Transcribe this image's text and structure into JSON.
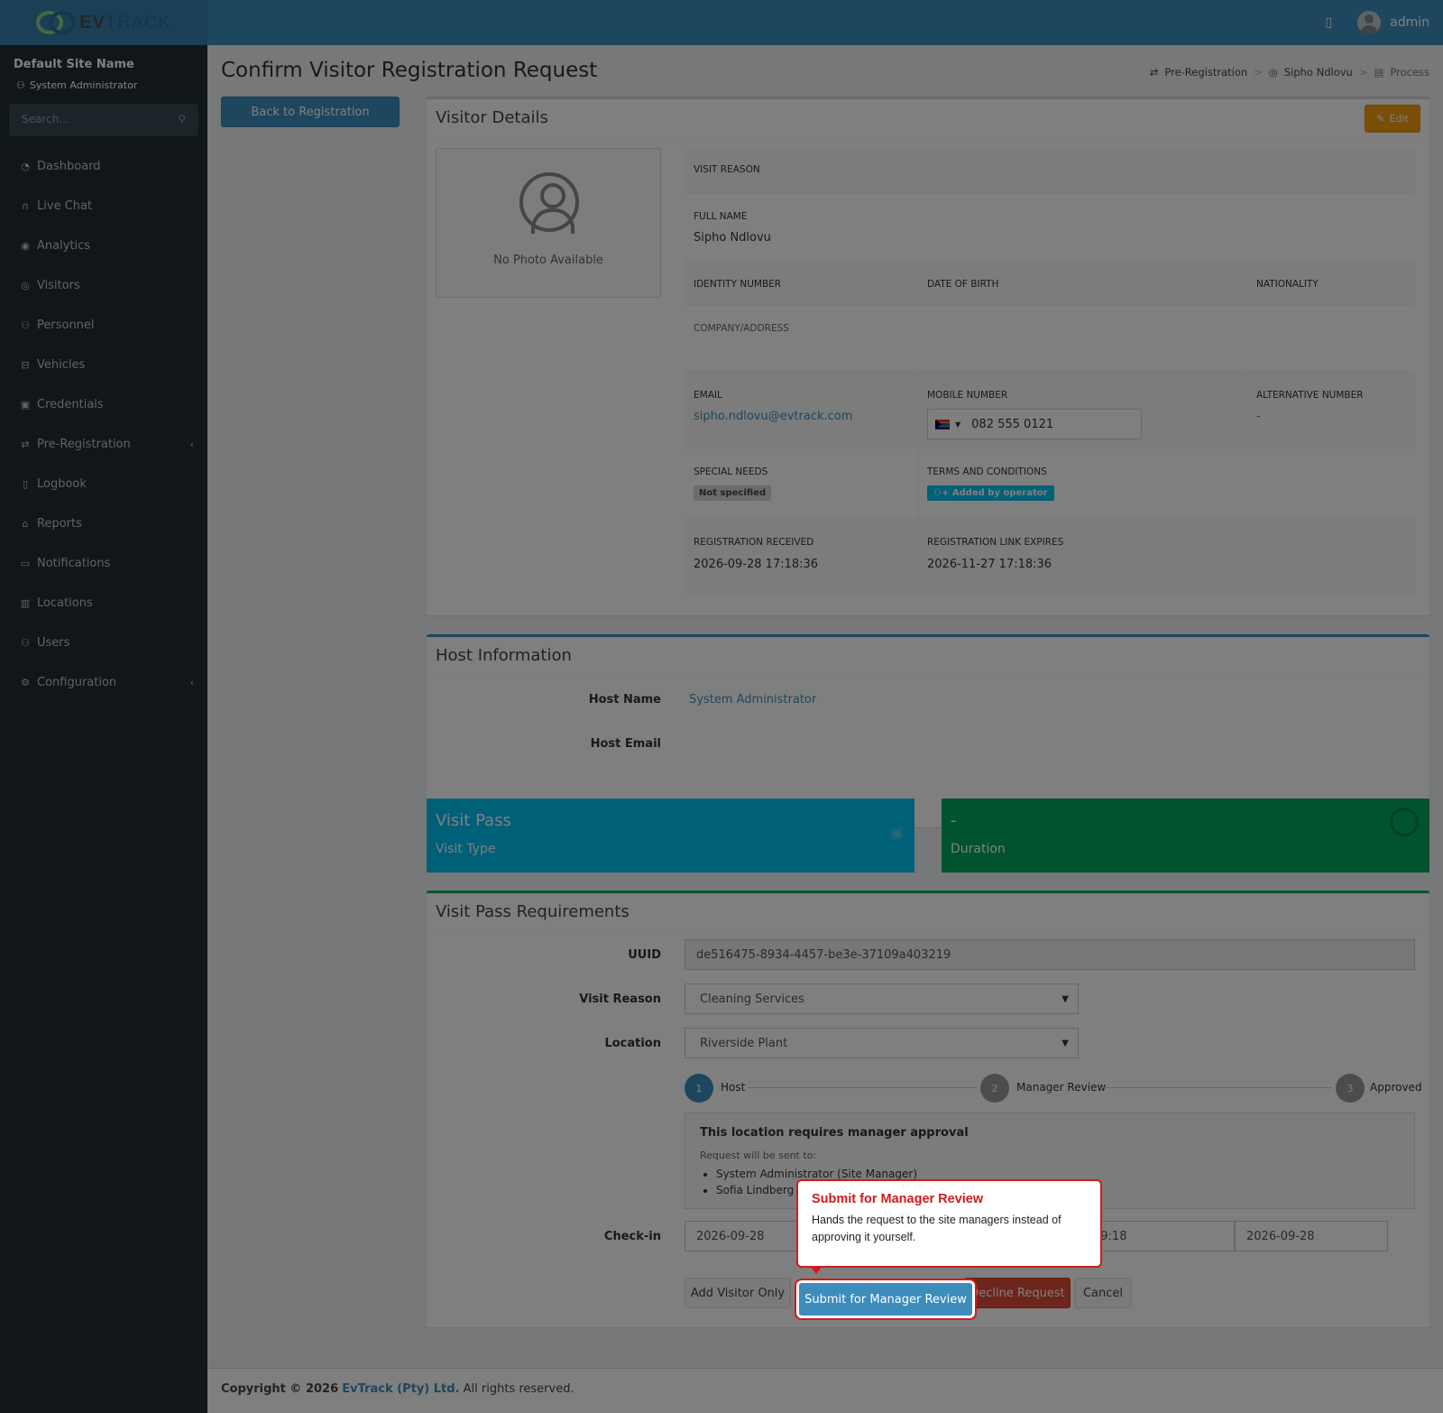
{
  "brand": {
    "part1": "EV",
    "part2": "TRACK"
  },
  "topbar": {
    "user": "admin"
  },
  "sidebar": {
    "site_name": "Default Site Name",
    "role": "System Administrator",
    "search_placeholder": "Search...",
    "items": [
      {
        "label": "Dashboard",
        "icon": "dashboard-icon"
      },
      {
        "label": "Live Chat",
        "icon": "headset-icon"
      },
      {
        "label": "Analytics",
        "icon": "target-icon"
      },
      {
        "label": "Visitors",
        "icon": "eye-icon"
      },
      {
        "label": "Personnel",
        "icon": "person-icon"
      },
      {
        "label": "Vehicles",
        "icon": "car-icon"
      },
      {
        "label": "Credentials",
        "icon": "id-card-icon"
      },
      {
        "label": "Pre-Registration",
        "icon": "arrows-icon"
      },
      {
        "label": "Logbook",
        "icon": "book-icon"
      },
      {
        "label": "Reports",
        "icon": "chart-icon"
      },
      {
        "label": "Notifications",
        "icon": "chat-icon"
      },
      {
        "label": "Locations",
        "icon": "map-icon"
      },
      {
        "label": "Users",
        "icon": "users-icon"
      },
      {
        "label": "Configuration",
        "icon": "gear-icon"
      }
    ]
  },
  "page": {
    "title": "Confirm Visitor Registration Request",
    "back_button": "Back to Registration",
    "breadcrumb": [
      "Pre-Registration",
      "Sipho Ndlovu",
      "Process"
    ]
  },
  "visitor": {
    "title": "Visitor Details",
    "edit": "Edit",
    "no_photo": "No Photo Available",
    "labels": {
      "visit_reason": "VISIT REASON",
      "full_name": "FULL NAME",
      "identity": "IDENTITY NUMBER",
      "dob": "DATE OF BIRTH",
      "nationality": "NATIONALITY",
      "company": "COMPANY/ADDRESS",
      "email": "EMAIL",
      "mobile": "MOBILE NUMBER",
      "alt": "ALTERNATIVE NUMBER",
      "special": "SPECIAL NEEDS",
      "terms": "TERMS AND CONDITIONS",
      "received": "REGISTRATION RECEIVED",
      "expires": "REGISTRATION LINK EXPIRES"
    },
    "full_name": "Sipho Ndlovu",
    "email": "sipho.ndlovu@evtrack.com",
    "mobile": "082 555 0121",
    "alt_number": "-",
    "special_needs": "Not specified",
    "terms": "Added by operator",
    "received": "2026-09-28 17:18:36",
    "expires": "2026-11-27 17:18:36"
  },
  "host": {
    "title": "Host Information",
    "name_label": "Host Name",
    "name": "System Administrator",
    "email_label": "Host Email"
  },
  "info_boxes": {
    "pass_title": "Visit Pass",
    "pass_sub": "Visit Type",
    "duration_title": "-",
    "duration_sub": "Duration",
    "colors": {
      "pass": "#00c0ef",
      "duration": "#00a65a"
    }
  },
  "requirements": {
    "title": "Visit Pass Requirements",
    "uuid_label": "UUID",
    "uuid": "de516475-8934-4457-be3e-37109a403219",
    "reason_label": "Visit Reason",
    "reason": "Cleaning Services",
    "location_label": "Location",
    "location": "Riverside Plant",
    "steps": [
      {
        "num": "1",
        "label": "Host"
      },
      {
        "num": "2",
        "label": "Manager Review"
      },
      {
        "num": "3",
        "label": "Approved"
      }
    ],
    "notice_title": "This location requires manager approval",
    "notice_sub": "Request will be sent to:",
    "recipients": [
      "System Administrator (Site Manager)",
      "Sofia Lindberg"
    ],
    "checkin_label": "Check-in",
    "checkin_date": "2026-09-28",
    "checkin_time": "19:18",
    "checkout_date": "2026-09-28"
  },
  "actions": {
    "add_only": "Add Visitor Only",
    "submit": "Submit for Manager Review",
    "decline": "Decline Request",
    "cancel": "Cancel"
  },
  "popover": {
    "title": "Submit for Manager Review",
    "body": "Hands the request to the site managers instead of approving it yourself."
  },
  "footer": {
    "prefix": "Copyright © 2026",
    "company": "EvTrack (Pty) Ltd.",
    "suffix": "All rights reserved."
  }
}
